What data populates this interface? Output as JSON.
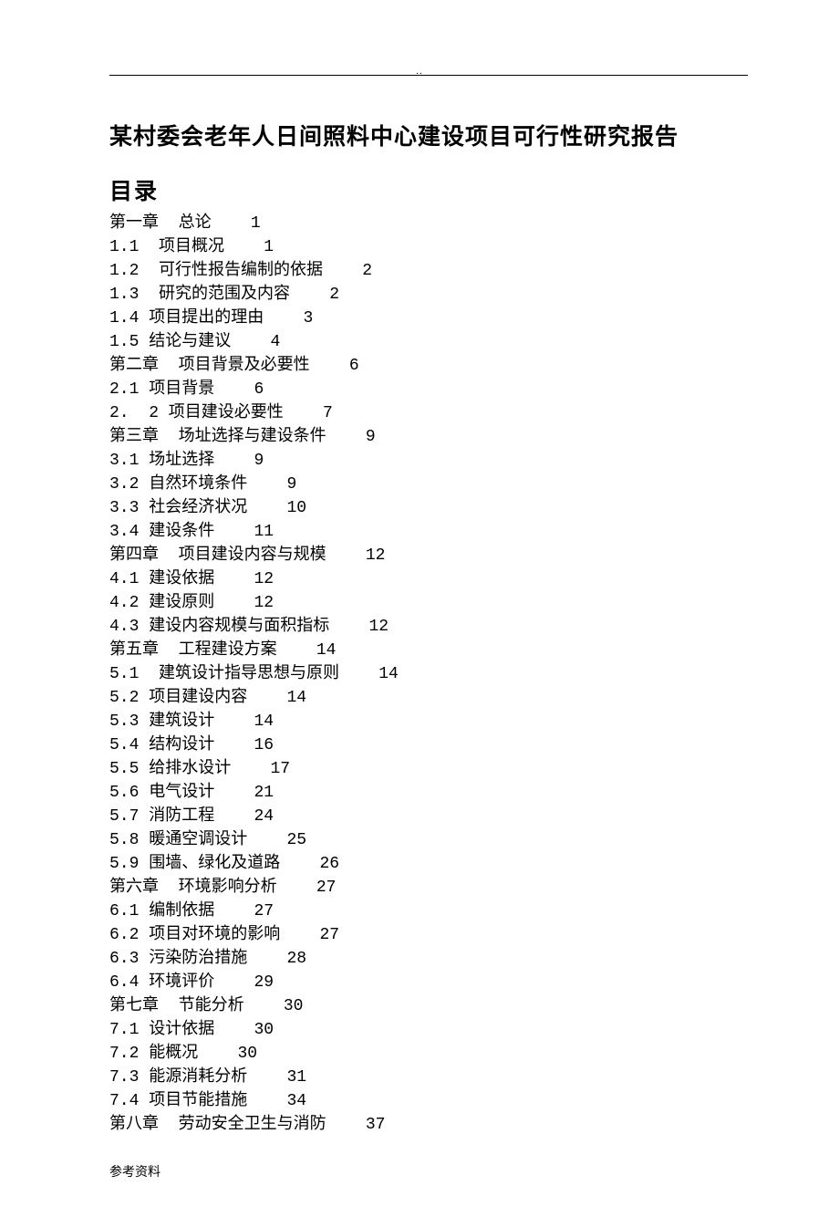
{
  "header_marker": "..",
  "title": "某村委会老年人日间照料中心建设项目可行性研究报告",
  "toc_heading": "目录",
  "toc": [
    {
      "label": "第一章  总论",
      "page": "1"
    },
    {
      "label": "1.1  项目概况",
      "page": "1"
    },
    {
      "label": "1.2  可行性报告编制的依据",
      "page": "2"
    },
    {
      "label": "1.3  研究的范围及内容",
      "page": "2"
    },
    {
      "label": "1.4 项目提出的理由",
      "page": "3"
    },
    {
      "label": "1.5 结论与建议",
      "page": "4"
    },
    {
      "label": "第二章  项目背景及必要性",
      "page": "6"
    },
    {
      "label": "2.1 项目背景",
      "page": "6"
    },
    {
      "label": "2.  2 项目建设必要性",
      "page": "7"
    },
    {
      "label": "第三章  场址选择与建设条件",
      "page": "9"
    },
    {
      "label": "3.1 场址选择",
      "page": "9"
    },
    {
      "label": "3.2 自然环境条件",
      "page": "9"
    },
    {
      "label": "3.3 社会经济状况",
      "page": "10"
    },
    {
      "label": "3.4 建设条件",
      "page": "11"
    },
    {
      "label": "第四章  项目建设内容与规模",
      "page": "12"
    },
    {
      "label": "4.1 建设依据",
      "page": "12"
    },
    {
      "label": "4.2 建设原则",
      "page": "12"
    },
    {
      "label": "4.3 建设内容规模与面积指标",
      "page": "12"
    },
    {
      "label": "第五章  工程建设方案",
      "page": "14"
    },
    {
      "label": "5.1  建筑设计指导思想与原则",
      "page": "14"
    },
    {
      "label": "5.2 项目建设内容",
      "page": "14"
    },
    {
      "label": "5.3 建筑设计",
      "page": "14"
    },
    {
      "label": "5.4 结构设计",
      "page": "16"
    },
    {
      "label": "5.5 给排水设计",
      "page": "17"
    },
    {
      "label": "5.6 电气设计",
      "page": "21"
    },
    {
      "label": "5.7 消防工程",
      "page": "24"
    },
    {
      "label": "5.8 暖通空调设计",
      "page": "25"
    },
    {
      "label": "5.9 围墙、绿化及道路",
      "page": "26"
    },
    {
      "label": "第六章  环境影响分析",
      "page": "27"
    },
    {
      "label": "6.1 编制依据",
      "page": "27"
    },
    {
      "label": "6.2 项目对环境的影响",
      "page": "27"
    },
    {
      "label": "6.3 污染防治措施",
      "page": "28"
    },
    {
      "label": "6.4 环境评价",
      "page": "29"
    },
    {
      "label": "第七章  节能分析",
      "page": "30"
    },
    {
      "label": "7.1 设计依据",
      "page": "30"
    },
    {
      "label": "7.2 能概况",
      "page": "30"
    },
    {
      "label": "7.3 能源消耗分析",
      "page": "31"
    },
    {
      "label": "7.4 项目节能措施",
      "page": "34"
    },
    {
      "label": "第八章  劳动安全卫生与消防",
      "page": "37"
    }
  ],
  "footer": "参考资料"
}
